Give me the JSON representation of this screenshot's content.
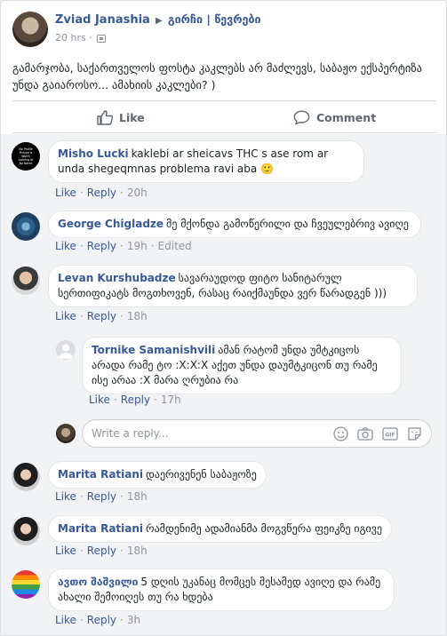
{
  "post": {
    "author": "Zviad Janashia",
    "arrow_icon": "triangle-right-icon",
    "group": "გირჩი | წევრები",
    "time": "20 hrs",
    "privacy_icon": "group-privacy-icon",
    "text": "გამარჯობა, საქართველოს ფოსტა კაკლებს არ მაძლევს, საბაჟო ექსპერტიზა უნდა გაიაროსო... ამახიის კაკლები? )",
    "like_label": "Like",
    "comment_label": "Comment"
  },
  "comments": [
    {
      "author": "Misho Lucki",
      "text": "kaklebi ar sheicavs THC s ase rom ar unda shegeqmnas problema ravi aba",
      "emoji": "🙂",
      "avatar_text": "No Profile Picture Is Worth Looking At No Name",
      "like": "Like",
      "reply": "Reply",
      "time": "20h"
    },
    {
      "author": "George Chigladze",
      "text": "მე მქონდა გამოწერილი და ჩვეულებრივ ავიღე",
      "like": "Like",
      "reply": "Reply",
      "time": "19h",
      "edited": "Edited"
    },
    {
      "author": "Levan Kurshubadze",
      "text": "სავარაუდოდ ფიტო სანიტარულ სერთიფიკატს მოგთხოვენ, რასაც რაიქმაუნდა ვერ წარადგენ )))",
      "like": "Like",
      "reply": "Reply",
      "time": "18h"
    },
    {
      "author": "Tornike Samanishvili",
      "text": "ამან რატომ უნდა უმტკიცოს არადა რამე ტო :X:X:X აქეთ უნდა დაუმტკიცონ თუ რამე ისე არაა :X მარა ღრუბია რა",
      "like": "Like",
      "reply": "Reply",
      "time": "17h"
    },
    {
      "author": "Marita Ratiani",
      "text": "დაერივენენ საბაჟოზე",
      "like": "Like",
      "reply": "Reply",
      "time": "18h"
    },
    {
      "author": "Marita Ratiani",
      "text": "რამდენიმე ადამიანმა მოგვწერა ფეიკზე იგივე",
      "like": "Like",
      "reply": "Reply",
      "time": "18h"
    },
    {
      "author": "ავთო შაშვილი",
      "text": "5 დღის უკანაც მომცეს მესამედ ავიღე და რამე ახალი შემოიღეს თუ რა ხდება",
      "like": "Like",
      "reply": "Reply",
      "time": "3h"
    }
  ],
  "reply_box": {
    "placeholder": "Write a reply...",
    "icons": [
      "emoji-icon",
      "camera-icon",
      "gif-icon",
      "sticker-icon"
    ]
  },
  "colors": {
    "link": "#385898",
    "meta": "#90949c",
    "action": "#606770",
    "bubble_bg": "#ffffff",
    "comments_bg": "#f2f3f5"
  }
}
